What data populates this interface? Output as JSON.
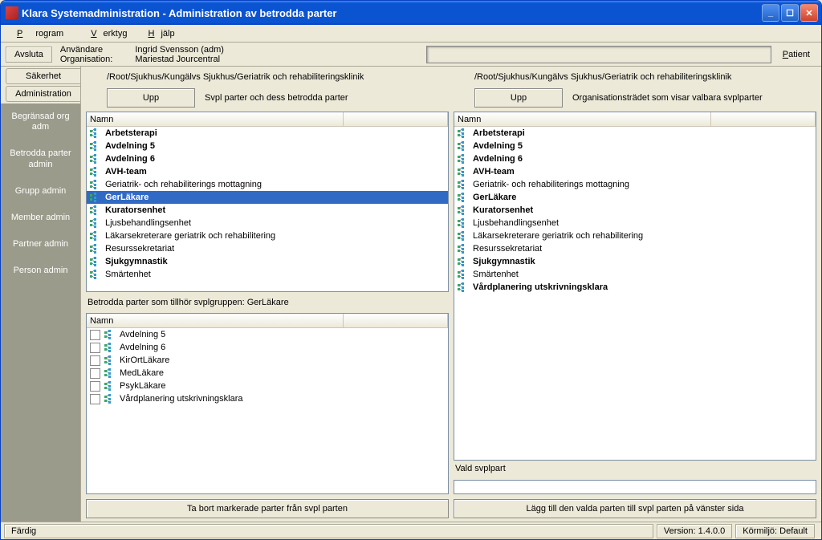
{
  "window": {
    "title": "Klara Systemadministration - Administration av betrodda parter"
  },
  "menu": {
    "program": "Program",
    "verktyg": "Verktyg",
    "hjalp": "Hjälp"
  },
  "toolbar": {
    "avsluta": "Avsluta",
    "anvandare_label": "Användare",
    "anvandare_value": "Ingrid Svensson (adm)",
    "organisation_label": "Organisation:",
    "organisation_value": "Mariestad Jourcentral",
    "patient_label": "Patient"
  },
  "vtabs": {
    "sakerhet": "Säkerhet",
    "administration": "Administration"
  },
  "sidenav": {
    "0": "Begränsad org adm",
    "1": "Betrodda parter admin",
    "2": "Grupp admin",
    "3": "Member admin",
    "4": "Partner admin",
    "5": "Person admin"
  },
  "left": {
    "path": "/Root/Sjukhus/Kungälvs Sjukhus/Geriatrik och rehabiliteringsklinik",
    "upp": "Upp",
    "desc": "Svpl parter och dess betrodda parter",
    "namn": "Namn",
    "items": [
      {
        "label": "Arbetsterapi",
        "bold": true
      },
      {
        "label": "Avdelning 5",
        "bold": true
      },
      {
        "label": "Avdelning 6",
        "bold": true
      },
      {
        "label": "AVH-team",
        "bold": true
      },
      {
        "label": "Geriatrik- och rehabiliterings mottagning",
        "bold": false
      },
      {
        "label": "GerLäkare",
        "bold": true,
        "selected": true
      },
      {
        "label": "Kuratorsenhet",
        "bold": true
      },
      {
        "label": "Ljusbehandlingsenhet",
        "bold": false
      },
      {
        "label": "Läkarsekreterare geriatrik och rehabilitering",
        "bold": false
      },
      {
        "label": "Resurssekretariat",
        "bold": false
      },
      {
        "label": "Sjukgymnastik",
        "bold": true
      },
      {
        "label": "Smärtenhet",
        "bold": false
      }
    ]
  },
  "betrodda": {
    "header": "Betrodda parter som tillhör svplgruppen: GerLäkare",
    "namn": "Namn",
    "items": [
      "Avdelning 5",
      "Avdelning 6",
      "KirOrtLäkare",
      "MedLäkare",
      "PsykLäkare",
      "Vårdplanering utskrivningsklara"
    ]
  },
  "right": {
    "path": "/Root/Sjukhus/Kungälvs Sjukhus/Geriatrik och rehabiliteringsklinik",
    "upp": "Upp",
    "desc": "Organisationsträdet som visar valbara svplparter",
    "namn": "Namn",
    "items": [
      {
        "label": "Arbetsterapi",
        "bold": true
      },
      {
        "label": "Avdelning 5",
        "bold": true
      },
      {
        "label": "Avdelning 6",
        "bold": true
      },
      {
        "label": "AVH-team",
        "bold": true
      },
      {
        "label": "Geriatrik- och rehabiliterings mottagning",
        "bold": false
      },
      {
        "label": "GerLäkare",
        "bold": true
      },
      {
        "label": "Kuratorsenhet",
        "bold": true
      },
      {
        "label": "Ljusbehandlingsenhet",
        "bold": false
      },
      {
        "label": "Läkarsekreterare geriatrik och rehabilitering",
        "bold": false
      },
      {
        "label": "Resurssekretariat",
        "bold": false
      },
      {
        "label": "Sjukgymnastik",
        "bold": true
      },
      {
        "label": "Smärtenhet",
        "bold": false
      },
      {
        "label": "Vårdplanering utskrivningsklara",
        "bold": true
      }
    ],
    "vald_label": "Vald svplpart"
  },
  "buttons": {
    "remove": "Ta bort markerade parter från svpl parten",
    "add": "Lägg till den valda parten till svpl parten på vänster sida"
  },
  "status": {
    "ready": "Färdig",
    "version": "Version: 1.4.0.0",
    "env": "Körmiljö: Default"
  }
}
